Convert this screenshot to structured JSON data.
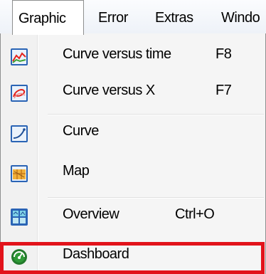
{
  "menubar": {
    "items": [
      "Graphic",
      "Error",
      "Extras",
      "Windo"
    ]
  },
  "menu": {
    "items": [
      {
        "label": "Curve versus time",
        "shortcut": "F8",
        "icon": "curve-versus-time-icon"
      },
      {
        "label": "Curve versus X",
        "shortcut": "F7",
        "icon": "curve-versus-x-icon"
      },
      {
        "label": "Curve",
        "shortcut": "",
        "icon": "curve-icon"
      },
      {
        "label": "Map",
        "shortcut": "",
        "icon": "map-icon"
      },
      {
        "label": "Overview",
        "shortcut": "Ctrl+O",
        "icon": "overview-icon"
      },
      {
        "label": "Dashboard",
        "shortcut": "",
        "icon": "dashboard-icon"
      }
    ]
  },
  "colors": {
    "highlight_border": "#e2131b",
    "menu_background": "#f5f5f5"
  }
}
